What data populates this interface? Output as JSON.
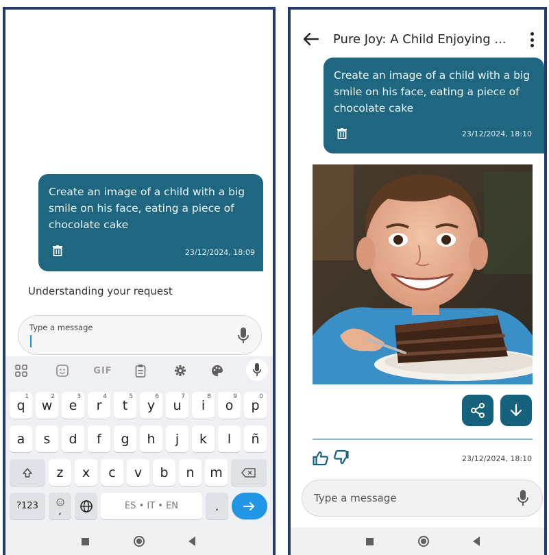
{
  "left_screen": {
    "user_message": {
      "text": "Create an image of a child with a big smile on his face, eating a piece of chocolate cake",
      "timestamp": "23/12/2024, 18:09"
    },
    "status_text": "Understanding your request",
    "input": {
      "placeholder": "Type a message",
      "value": ""
    },
    "keyboard": {
      "toolbar": [
        "apps-icon",
        "sticker-icon",
        "GIF",
        "clipboard-icon",
        "settings-icon",
        "palette-icon",
        "mic-icon"
      ],
      "row1": [
        {
          "key": "q",
          "hint": "1"
        },
        {
          "key": "w",
          "hint": "2"
        },
        {
          "key": "e",
          "hint": "3"
        },
        {
          "key": "r",
          "hint": "4"
        },
        {
          "key": "t",
          "hint": "5"
        },
        {
          "key": "y",
          "hint": "6"
        },
        {
          "key": "u",
          "hint": "7"
        },
        {
          "key": "i",
          "hint": "8"
        },
        {
          "key": "o",
          "hint": "9"
        },
        {
          "key": "p",
          "hint": "0"
        }
      ],
      "row2": [
        "a",
        "s",
        "d",
        "f",
        "g",
        "h",
        "j",
        "k",
        "l",
        "ñ"
      ],
      "row3": [
        "z",
        "x",
        "c",
        "v",
        "b",
        "n",
        "m"
      ],
      "row4": {
        "symbols": "?123",
        "comma": ",",
        "space": "ES • IT • EN",
        "period": "."
      }
    }
  },
  "right_screen": {
    "title": "Pure Joy: A Child Enjoying ...",
    "user_message": {
      "text": "Create an image of a child with a big smile on his face, eating a piece of chocolate cake",
      "timestamp": "23/12/2024, 18:10"
    },
    "response_timestamp": "23/12/2024, 18:10",
    "input": {
      "placeholder": "Type a message"
    }
  },
  "colors": {
    "bubble": "#1f6781",
    "action_button": "#16627d",
    "phone_border": "#263a6e",
    "enter_key": "#2196e6"
  }
}
